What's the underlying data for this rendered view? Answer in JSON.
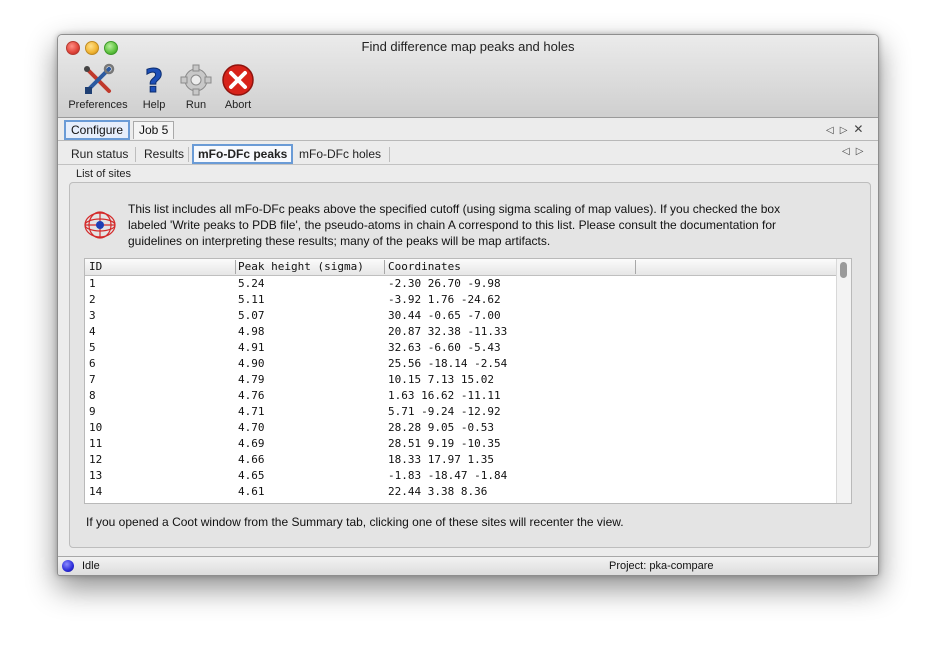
{
  "window": {
    "title": "Find difference map peaks and holes"
  },
  "toolbar": {
    "preferences_label": "Preferences",
    "help_label": "Help",
    "run_label": "Run",
    "abort_label": "Abort"
  },
  "job_tabs": {
    "configure_label": "Configure",
    "job_label": "Job 5"
  },
  "sub_tabs": {
    "run_status": "Run status",
    "results": "Results",
    "peaks": "mFo-DFc peaks",
    "holes": "mFo-DFc holes"
  },
  "group": {
    "label": "List of sites",
    "description": "This list includes all mFo-DFc peaks above the specified cutoff (using sigma scaling of map values).  If you checked the box labeled 'Write peaks to PDB file', the pseudo-atoms in chain A correspond to this list.  Please consult the documentation for guidelines on interpreting these results; many of the peaks will be map artifacts.",
    "footnote": "If you opened a Coot window from the Summary tab, clicking one of these sites will recenter the view."
  },
  "table": {
    "headers": {
      "id": "ID",
      "height": "Peak height (sigma)",
      "coords": "Coordinates"
    },
    "rows": [
      {
        "id": "1",
        "height": "5.24",
        "coords": "-2.30 26.70 -9.98"
      },
      {
        "id": "2",
        "height": "5.11",
        "coords": "-3.92 1.76 -24.62"
      },
      {
        "id": "3",
        "height": "5.07",
        "coords": "30.44 -0.65 -7.00"
      },
      {
        "id": "4",
        "height": "4.98",
        "coords": "20.87 32.38 -11.33"
      },
      {
        "id": "5",
        "height": "4.91",
        "coords": "32.63 -6.60 -5.43"
      },
      {
        "id": "6",
        "height": "4.90",
        "coords": "25.56 -18.14 -2.54"
      },
      {
        "id": "7",
        "height": "4.79",
        "coords": "10.15 7.13 15.02"
      },
      {
        "id": "8",
        "height": "4.76",
        "coords": "1.63 16.62 -11.11"
      },
      {
        "id": "9",
        "height": "4.71",
        "coords": "5.71 -9.24 -12.92"
      },
      {
        "id": "10",
        "height": "4.70",
        "coords": "28.28 9.05 -0.53"
      },
      {
        "id": "11",
        "height": "4.69",
        "coords": "28.51 9.19 -10.35"
      },
      {
        "id": "12",
        "height": "4.66",
        "coords": "18.33 17.97 1.35"
      },
      {
        "id": "13",
        "height": "4.65",
        "coords": "-1.83 -18.47 -1.84"
      },
      {
        "id": "14",
        "height": "4.61",
        "coords": "22.44 3.38 8.36"
      }
    ]
  },
  "status": {
    "text": "Idle",
    "project": "Project: pka-compare"
  }
}
